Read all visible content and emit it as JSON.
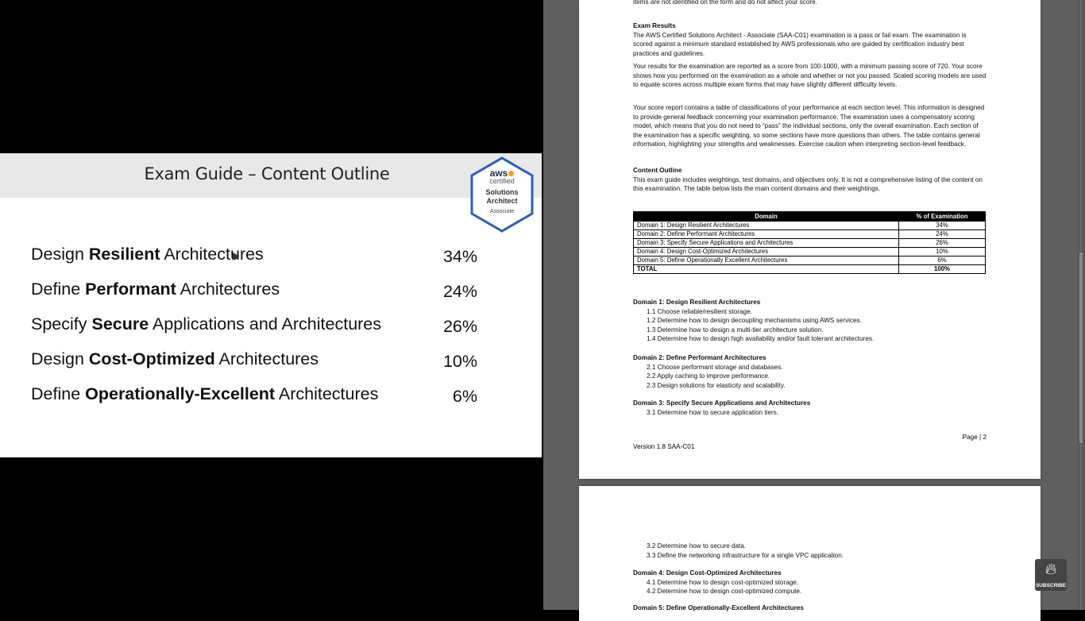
{
  "slide": {
    "title": "Exam Guide – Content Outline",
    "badge": {
      "aws": "aws",
      "certified": "certified",
      "solutions": "Solutions",
      "architect": "Architect",
      "associate": "Associate"
    },
    "domains": [
      {
        "pre": "Design ",
        "bold": "Resilient",
        "post": " Architectures",
        "pct": "34%"
      },
      {
        "pre": "Define ",
        "bold": "Performant",
        "post": " Architectures",
        "pct": "24%"
      },
      {
        "pre": "Specify ",
        "bold": "Secure",
        "post": " Applications and Architectures",
        "pct": "26%"
      },
      {
        "pre": "Design ",
        "bold": "Cost-Optimized",
        "post": " Architectures",
        "pct": "10%"
      },
      {
        "pre": "Define ",
        "bold": "Operationally-Excellent",
        "post": " Architectures",
        "pct": "6%"
      }
    ]
  },
  "doc": {
    "top_text": "items are not identified on the form and do not affect your score.",
    "exam_results_heading": "Exam Results",
    "p1": "The AWS Certified Solutions Architect - Associate (SAA-C01) examination is a pass or fail exam. The examination is scored against a minimum standard established by AWS professionals who are guided by certification industry best practices and guidelines.",
    "p2": "Your results for the examination are reported as a score from 100-1000, with a minimum passing score of 720. Your score shows how you performed on the examination as a whole and whether or not you passed. Scaled scoring models are used to equate scores across multiple exam forms that may have slightly different difficulty levels.",
    "p3": "Your score report contains a table of classifications of your performance at each section level. This information is designed to provide general feedback concerning your examination performance. The examination uses a compensatory scoring model, which means that you do not need to “pass” the individual sections, only the overall examination. Each section of the examination has a specific weighting, so some sections have more questions than others. The table contains general information, highlighting your strengths and weaknesses. Exercise caution when interpreting section-level feedback.",
    "content_outline_heading": "Content Outline",
    "p4": "This exam guide includes weightings, test domains, and objectives only. It is not a comprehensive listing of the content on this examination. The table below lists the main content domains and their weightings.",
    "table": {
      "headers": [
        "Domain",
        "% of Examination"
      ],
      "rows": [
        [
          "Domain 1: Design Resilient Architectures",
          "34%"
        ],
        [
          "Domain 2: Define Performant Architectures",
          "24%"
        ],
        [
          "Domain 3: Specify Secure Applications and Architectures",
          "26%"
        ],
        [
          "Domain 4: Design Cost-Optimized Architectures",
          "10%"
        ],
        [
          "Domain 5: Define Operationally Excellent Architectures",
          "6%"
        ],
        [
          "TOTAL",
          "100%"
        ]
      ]
    },
    "d1": {
      "h": "Domain 1: Design Resilient Architectures",
      "items": [
        "1.1  Choose reliable/resilient storage.",
        "1.2  Determine how to design decoupling mechanisms using AWS services.",
        "1.3  Determine how to design a multi-tier architecture solution.",
        "1.4  Determine how to design high availability and/or fault tolerant architectures."
      ]
    },
    "d2": {
      "h": "Domain 2: Define Performant Architectures",
      "items": [
        "2.1  Choose performant storage and databases.",
        "2.2  Apply caching to improve performance.",
        "2.3  Design solutions for elasticity and scalability."
      ]
    },
    "d3": {
      "h": "Domain 3: Specify Secure Applications and Architectures",
      "items": [
        "3.1  Determine how to secure application tiers."
      ]
    },
    "page_label": "Page | 2",
    "version": "Version 1.8 SAA-C01",
    "page2_items": [
      "3.2  Determine how to secure data.",
      "3.3  Define the networking infrastructure for a single VPC application."
    ],
    "d4": {
      "h": "Domain 4: Design Cost-Optimized Architectures",
      "items": [
        "4.1  Determine how to design cost-optimized storage.",
        "4.2  Determine how to design cost-optimized compute."
      ]
    },
    "d5": {
      "h": "Domain 5: Define Operationally-Excellent Architectures"
    }
  },
  "subscribe": {
    "label": "SUBSCRIBE"
  },
  "icons": {
    "subscribe": "flame-icon"
  }
}
